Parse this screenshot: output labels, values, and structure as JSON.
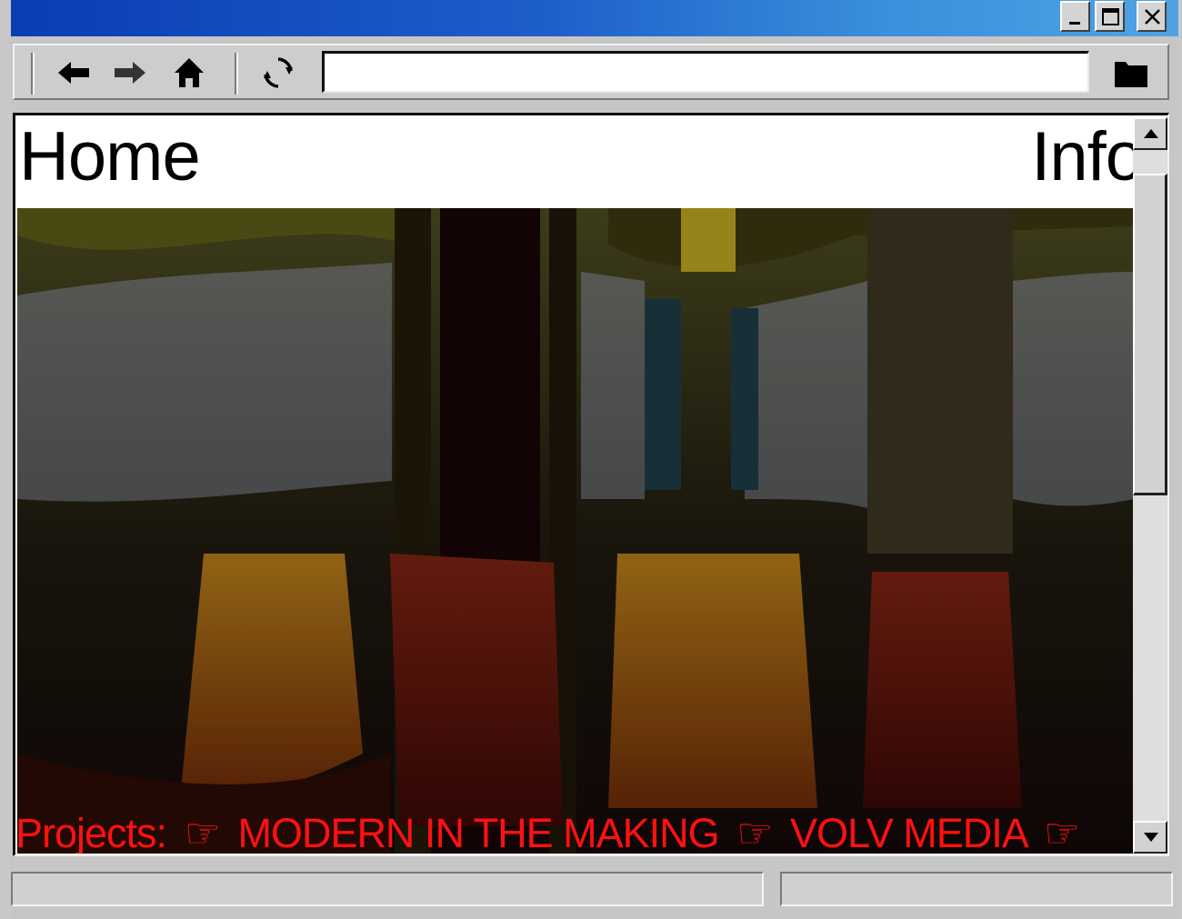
{
  "window": {
    "minimize_icon": "minimize-icon",
    "maximize_icon": "maximize-icon",
    "close_icon": "close-icon",
    "accent": "#0a3db3"
  },
  "toolbar": {
    "icons": [
      "back-arrow-icon",
      "forward-arrow-icon",
      "home-icon",
      "reload-icon",
      "folder-icon"
    ],
    "address_value": ""
  },
  "nav": {
    "home": "Home",
    "info": "Info"
  },
  "ticker": {
    "label": "Projects:",
    "pointer": "☞",
    "items": [
      "MODERN IN THE MAKING",
      "VOLV MEDIA"
    ],
    "color": "#ff1111"
  },
  "status": {
    "left": "",
    "right": ""
  }
}
